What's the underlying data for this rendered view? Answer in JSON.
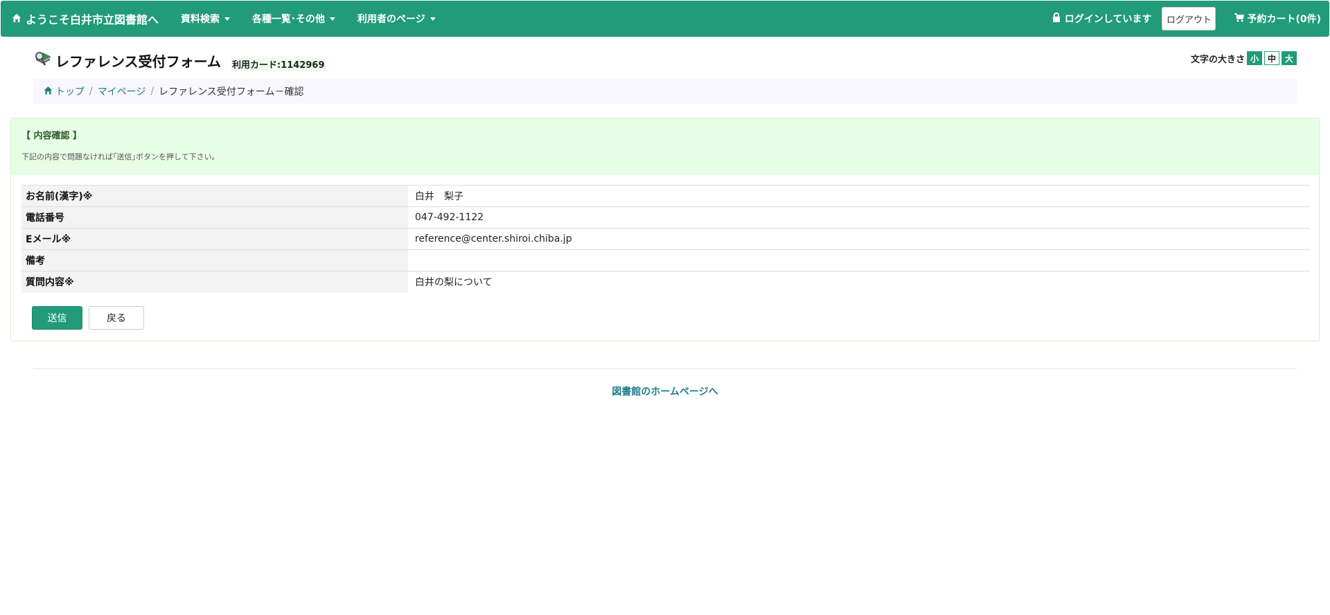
{
  "navbar": {
    "brand": "ようこそ白井市立図書館へ",
    "menu": [
      {
        "label": "資料検索"
      },
      {
        "label": "各種一覧･その他"
      },
      {
        "label": "利用者のページ"
      }
    ],
    "login_status": "ログインしています",
    "logout_label": "ログアウト",
    "cart_label": "予約カート(0件)"
  },
  "header": {
    "title": "レファレンス受付フォーム",
    "card": "利用カード:1142969",
    "font_size_label": "文字の大きさ",
    "font_sizes": [
      "小",
      "中",
      "大"
    ]
  },
  "breadcrumb": {
    "top": "トップ",
    "mypage": "マイページ",
    "current": "レファレンス受付フォーム－確認"
  },
  "panel": {
    "title": "【 内容確認 】",
    "note": "下記の内容で問題なければ｢送信｣ボタンを押して下さい。",
    "rows": [
      {
        "label": "お名前(漢字)※",
        "value": "白井　梨子"
      },
      {
        "label": "電話番号",
        "value": "047-492-1122"
      },
      {
        "label": "Eメール※",
        "value": "reference@center.shiroi.chiba.jp"
      },
      {
        "label": "備考",
        "value": ""
      },
      {
        "label": "質問内容※",
        "value": "白井の梨について"
      }
    ],
    "send_label": "送信",
    "back_label": "戻る"
  },
  "footer": {
    "homepage_link": "図書館のホームページへ"
  },
  "colors": {
    "primary": "#219b79",
    "heading_bg": "#e8fde6",
    "link": "#1d7d8a"
  }
}
